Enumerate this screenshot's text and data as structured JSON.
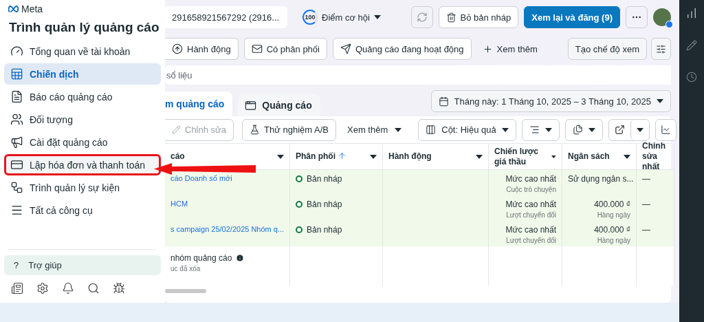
{
  "sidebar": {
    "logo": "Meta",
    "title": "Trình quản lý quảng cáo",
    "items": [
      {
        "label": "Tổng quan về tài khoản",
        "selected": false,
        "highlighted": false
      },
      {
        "label": "Chiến dịch",
        "selected": true,
        "highlighted": false
      },
      {
        "label": "Báo cáo quảng cáo",
        "selected": false,
        "highlighted": false
      },
      {
        "label": "Đối tượng",
        "selected": false,
        "highlighted": false
      },
      {
        "label": "Cài đặt quảng cáo",
        "selected": false,
        "highlighted": false
      },
      {
        "label": "Lập hóa đơn và thanh toán",
        "selected": false,
        "highlighted": true
      },
      {
        "label": "Trình quản lý sự kiện",
        "selected": false,
        "highlighted": false
      },
      {
        "label": "Tất cả công cụ",
        "selected": false,
        "highlighted": false
      }
    ],
    "help": {
      "icon": "?",
      "label": "Trợ giúp"
    }
  },
  "topbar": {
    "account": "291658921567292 (2916...",
    "score": "100",
    "score_label": "Điểm cơ hội",
    "discard": "Bỏ bản nháp",
    "publish": "Xem lại và đăng (9)"
  },
  "filters": [
    {
      "label": "Hành động"
    },
    {
      "label": "Có phân phối"
    },
    {
      "label": "Quảng cáo đang hoạt động"
    }
  ],
  "more_filters": "Xem thêm",
  "create_view": "Tạo chế độ xem",
  "search": {
    "placeholder": "sổ liệu"
  },
  "tabs": [
    {
      "label": "m quảng cáo",
      "selected": true
    },
    {
      "label": "Quảng cáo",
      "selected": false
    }
  ],
  "date_range": "Tháng này: 1 Tháng 10, 2025 – 3 Tháng 10, 2025",
  "toolbar": {
    "edit": {
      "label": "Chỉnh sửa",
      "disabled": true
    },
    "ab_test": "Thử nghiệm A/B",
    "more": "Xem thêm",
    "columns": "Cột: Hiệu quả"
  },
  "table": {
    "columns": [
      {
        "label": "cáo",
        "sorted": false
      },
      {
        "label": "Phân phối",
        "sorted": true
      },
      {
        "label": "Hành động",
        "sorted": false
      },
      {
        "label": "Chiến lược giá thầu",
        "sorted": false
      },
      {
        "label": "Ngân sách",
        "sorted": false
      },
      {
        "label": "Chinh sửa nhất",
        "sorted": false
      }
    ],
    "rows": [
      {
        "name": "cáo Doanh số mới",
        "edited": true,
        "delivery": "Bản nháp",
        "bid": "Mức cao nhất",
        "bid_sub": "Cuộc trò chuyện",
        "budget": "Sử dụng ngân s...",
        "last_edit": "—"
      },
      {
        "name": "HCM",
        "edited": true,
        "delivery": "Bản nháp",
        "bid": "Mức cao nhất",
        "bid_sub": "Lượt chuyển đổi",
        "budget": "400.000 ₫",
        "budget_sub": "Hàng ngày",
        "last_edit": "—"
      },
      {
        "name": "s campaign 25/02/2025 Nhóm q...",
        "edited": true,
        "delivery": "Bản nháp",
        "bid": "Mức cao nhất",
        "bid_sub": "Lượt chuyển đổi",
        "budget": "400.000 ₫",
        "budget_sub": "Hàng ngày",
        "last_edit": "—"
      }
    ],
    "summary": {
      "title": "nhóm quảng cáo",
      "subtitle": "uc đã xóa"
    }
  }
}
